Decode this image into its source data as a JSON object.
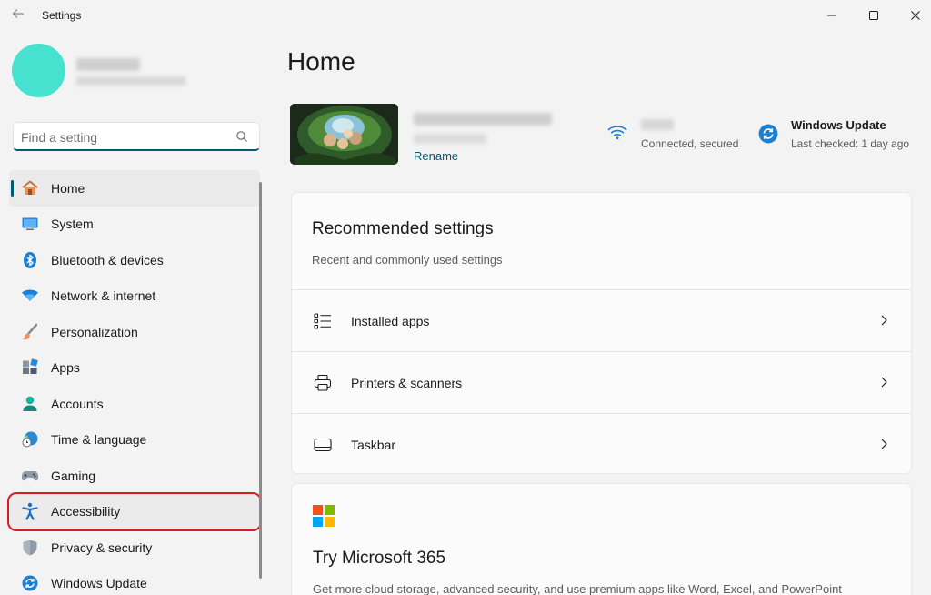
{
  "window": {
    "app_title": "Settings",
    "back_icon": "back-arrow-icon",
    "controls": [
      "minimize-icon",
      "maximize-icon",
      "close-icon"
    ]
  },
  "search": {
    "placeholder": "Find a setting",
    "value": ""
  },
  "sidebar": {
    "items": [
      {
        "label": "Home",
        "icon": "home-icon",
        "active": true
      },
      {
        "label": "System",
        "icon": "system-icon"
      },
      {
        "label": "Bluetooth & devices",
        "icon": "bluetooth-icon"
      },
      {
        "label": "Network & internet",
        "icon": "wifi-icon"
      },
      {
        "label": "Personalization",
        "icon": "brush-icon"
      },
      {
        "label": "Apps",
        "icon": "apps-icon"
      },
      {
        "label": "Accounts",
        "icon": "person-icon"
      },
      {
        "label": "Time & language",
        "icon": "globe-clock-icon"
      },
      {
        "label": "Gaming",
        "icon": "gamepad-icon"
      },
      {
        "label": "Accessibility",
        "icon": "accessibility-icon",
        "highlighted": true
      },
      {
        "label": "Privacy & security",
        "icon": "shield-icon"
      },
      {
        "label": "Windows Update",
        "icon": "update-icon"
      }
    ]
  },
  "main": {
    "page_title": "Home",
    "device": {
      "rename_label": "Rename"
    },
    "network": {
      "status": "Connected, secured"
    },
    "windows_update": {
      "title": "Windows Update",
      "subtitle": "Last checked: 1 day ago"
    },
    "recommended": {
      "title": "Recommended settings",
      "subtitle": "Recent and commonly used settings",
      "rows": [
        {
          "label": "Installed apps",
          "icon": "list-icon"
        },
        {
          "label": "Printers & scanners",
          "icon": "printer-icon"
        },
        {
          "label": "Taskbar",
          "icon": "taskbar-icon"
        }
      ]
    },
    "microsoft365": {
      "title": "Try Microsoft 365",
      "description": "Get more cloud storage, advanced security, and use premium apps like Word, Excel, and PowerPoint"
    }
  },
  "colors": {
    "accent": "#005a70",
    "highlight_outline": "#d91c24",
    "avatar": "#46e1cf"
  }
}
